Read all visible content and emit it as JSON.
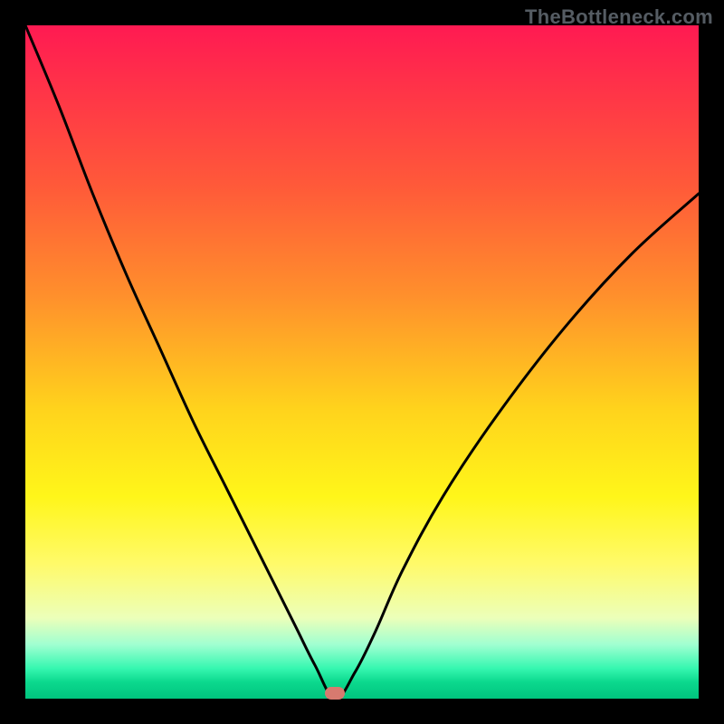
{
  "watermark": "TheBottleneck.com",
  "marker": {
    "x_frac": 0.46,
    "y_frac": 0.992
  },
  "chart_data": {
    "type": "line",
    "title": "",
    "xlabel": "",
    "ylabel": "",
    "xlim": [
      0,
      1
    ],
    "ylim": [
      0,
      1
    ],
    "series": [
      {
        "name": "bottleneck-curve",
        "x": [
          0.0,
          0.05,
          0.1,
          0.15,
          0.2,
          0.25,
          0.3,
          0.35,
          0.4,
          0.43,
          0.46,
          0.49,
          0.52,
          0.56,
          0.62,
          0.7,
          0.8,
          0.9,
          1.0
        ],
        "y": [
          1.0,
          0.88,
          0.75,
          0.63,
          0.52,
          0.41,
          0.31,
          0.21,
          0.11,
          0.05,
          0.0,
          0.04,
          0.1,
          0.19,
          0.3,
          0.42,
          0.55,
          0.66,
          0.75
        ]
      }
    ],
    "annotations": [
      {
        "name": "optimal-marker",
        "x": 0.46,
        "y": 0.0
      }
    ],
    "background_gradient": {
      "top": "#ff1a52",
      "mid": "#fff61a",
      "bottom": "#00c47e"
    }
  }
}
